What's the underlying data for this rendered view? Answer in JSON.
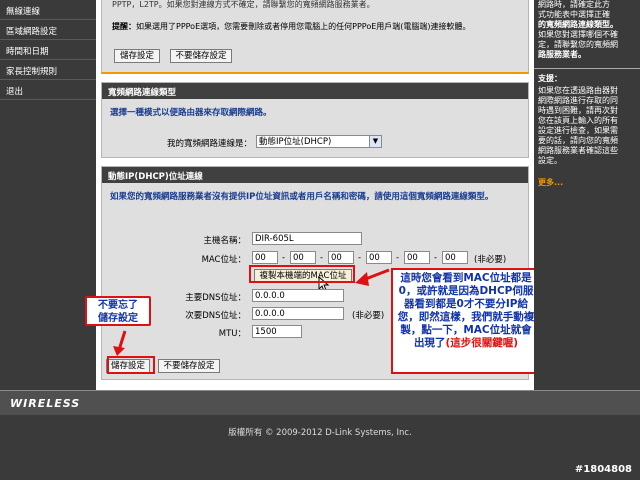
{
  "sidebar": {
    "items": [
      {
        "label": "無線連線"
      },
      {
        "label": "區域網路設定"
      },
      {
        "label": "時間和日期"
      },
      {
        "label": "家長控制規則"
      },
      {
        "label": "退出"
      }
    ]
  },
  "top": {
    "partial_text": "PPTP，L2TP。如果您對連線方式不確定，請聯繫您的寬頻網路服務業者。",
    "tip_label": "提醒：",
    "tip_text": "如果選用了PPPoE選項，您需要刪除或者停用您電腦上的任何PPPoE用戶端(電腦端)連接軟體。",
    "save_label": "儲存設定",
    "dont_save_label": "不要儲存設定"
  },
  "conn_type": {
    "header": "寬頻網路連線類型",
    "description": "選擇一種模式以便路由器來存取網際網路。",
    "select_label": "我的寬頻網路連線是：",
    "select_value": "動態IP位址(DHCP)"
  },
  "dhcp": {
    "header": "動態IP(DHCP)位址連線",
    "description": "如果您的寬頻網路服務業者沒有提供IP位址資訊或者用戶名稱和密碼，請使用這個寬頻網路連線類型。",
    "host_label": "主機名稱：",
    "host_value": "DIR-605L",
    "mac_label": "MAC位址：",
    "mac_values": [
      "00",
      "00",
      "00",
      "00",
      "00",
      "00"
    ],
    "optional_label": "(非必要)",
    "clone_label": "複製本機端的MAC位址",
    "dns1_label": "主要DNS位址：",
    "dns1_value": "0.0.0.0",
    "dns2_label": "次要DNS位址：",
    "dns2_value": "0.0.0.0",
    "dns2_optional": "(非必要)",
    "mtu_label": "MTU：",
    "mtu_value": "1500",
    "save_label": "儲存設定",
    "dont_save_label": "不要儲存設定"
  },
  "help": {
    "top_lines": [
      "網路時，請確定此方",
      "式功能表中選擇正確",
      "的寬頻網路連線類型。",
      "如果您對選擇哪個不確",
      "定，請聯繫您的寬頻網",
      "路服務業者。"
    ],
    "tips_title": "支援：",
    "tips_lines": [
      "如果您在透過路由器對",
      "網際網路進行存取的同",
      "時遇到困難，請再次對",
      "您在該頁上輸入的所有",
      "設定進行檢查，如果需",
      "要的話，請向您的寬頻",
      "網路服務業者確認這些",
      "設定。"
    ],
    "more_label": "更多..."
  },
  "brand": {
    "wireless_label": "WIRELESS"
  },
  "footer": {
    "copyright": "版權所有 © 2009-2012 D-Link Systems, Inc.",
    "watermark": "#1804808"
  },
  "annotations": {
    "remember_lines": [
      "不要忘了",
      "儲存設定"
    ],
    "mac_note_blue": "這時您會看到MAC位址都是0，或許就是因為DHCP伺服器看到都是0才不要分IP給您，即然這樣，我們就手動複製，點一下，MAC位址就會出現了",
    "mac_note_red": "(這步很關鍵喔)"
  },
  "colors": {
    "dlink_orange": "#f39800",
    "annotation_red": "#dd1111",
    "annotation_blue": "#1133aa",
    "section_header": "#404040"
  }
}
